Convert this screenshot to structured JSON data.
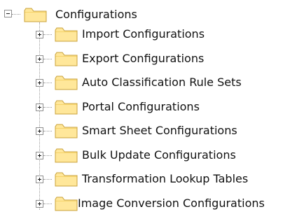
{
  "tree": {
    "root": {
      "label": "Configurations",
      "icon": "folder-icon",
      "expanded": true
    },
    "children": [
      {
        "label": "Import Configurations",
        "icon": "folder-icon",
        "expanded": false
      },
      {
        "label": "Export Configurations",
        "icon": "folder-icon",
        "expanded": false
      },
      {
        "label": "Auto Classification Rule Sets",
        "icon": "folder-icon",
        "expanded": false
      },
      {
        "label": "Portal Configurations",
        "icon": "folder-icon",
        "expanded": false
      },
      {
        "label": "Smart Sheet Configurations",
        "icon": "folder-icon",
        "expanded": false
      },
      {
        "label": "Bulk Update Configurations",
        "icon": "folder-icon",
        "expanded": false
      },
      {
        "label": "Transformation Lookup Tables",
        "icon": "folder-icon",
        "expanded": false
      },
      {
        "label": "Image Conversion Configurations",
        "icon": "folder-icon",
        "expanded": false
      }
    ]
  },
  "colors": {
    "folder_fill": "#ffe79a",
    "folder_edge": "#c8a03a",
    "connector": "#9a9a9a",
    "text": "#111111"
  }
}
